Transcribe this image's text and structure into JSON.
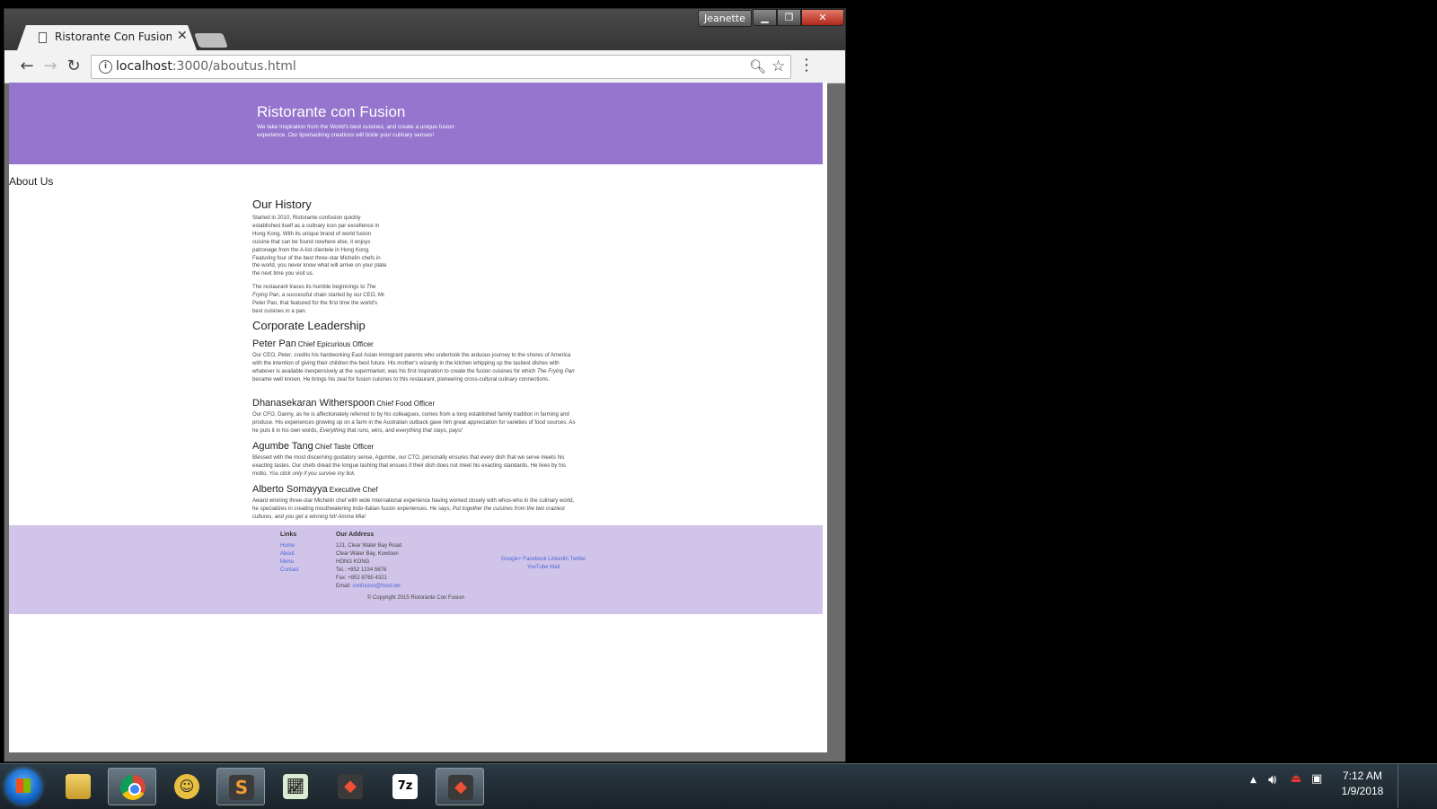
{
  "window": {
    "user_badge": "Jeanette",
    "tab_title": "Ristorante Con Fusion: A",
    "url_host": "localhost",
    "url_path": ":3000/aboutus.html"
  },
  "page": {
    "brand_title": "Ristorante con Fusion",
    "brand_tagline": "We take inspiration from the World's best cuisines, and create a unique fusion experience. Our lipsmacking creations will tickle your culinary senses!",
    "page_heading": "About Us",
    "history": {
      "heading": "Our History",
      "p1": "Started in 2010, Ristorante confusion quickly established itself as a culinary icon par excellence in Hong Kong. With its unique brand of world fusion cuisine that can be found nowhere else, it enjoys patronage from the A-list clientele in Hong Kong. Featuring four of the best three-star Michelin chefs in the world, you never know what will arrive on your plate the next time you visit us.",
      "p2_prefix": "The restaurant traces its humble beginnings to ",
      "p2_italic": "The Frying Pan",
      "p2_suffix": ", a successful chain started by our CEO, Mr. Peter Pan, that featured for the first time the world's best cuisines in a pan."
    },
    "leadership": {
      "heading": "Corporate Leadership",
      "leaders": [
        {
          "name": "Peter Pan",
          "role": "Chief Epicurious Officer",
          "bio_a": "Our CEO, ",
          "bio_a_italic": "Peter",
          "bio_b": ", credits his hardworking East Asian immigrant parents who undertook the arduous journey to the shores of America with the intention of giving their children the best future. His mother's wizardy in the kitchen whipping up the tastiest dishes with whatever is available inexpensively at the supermarket, was his first inspiration to create the fusion cuisines for which ",
          "bio_b_italic": "The Frying Pan",
          "bio_c": " became well known. He brings his zeal for fusion cuisines to this restaurant, pioneering cross-cultural culinary connections."
        },
        {
          "name": "Dhanasekaran Witherspoon",
          "role": "Chief Food Officer",
          "bio_a": "Our CFO, Danny, as he is affectionately referred to by his colleagues, comes from a long established family tradition in farming and produce. His experiences growing up on a farm in the Australian outback gave him great appreciation for varieties of food sources. As he puts it in his own words, ",
          "bio_a_italic": "Everything that runs, wins, and everything that stays, pays!",
          "bio_b": "",
          "bio_b_italic": "",
          "bio_c": ""
        },
        {
          "name": "Agumbe Tang",
          "role": "Chief Taste Officer",
          "bio_a": "Blessed with the most discerning gustatory sense, Agumbe, our CTO, personally ensures that every dish that we serve meets his exacting tastes. Our chefs dread the tongue lashing that ensues if their dish does not meet his exacting standards. He lives by his motto, ",
          "bio_a_italic": "You click only if you survive my lick.",
          "bio_b": "",
          "bio_b_italic": "",
          "bio_c": ""
        },
        {
          "name": "Alberto Somayya",
          "role": "Executive Chef",
          "bio_a": "Award winning three-star Michelin chef with wide International experience having worked closely with whos-who in the culinary world, he specializes in creating mouthwatering Indo-Italian fusion experiences. He says, ",
          "bio_a_italic": "Put together the cuisines from the two craziest cultures, and you get a winning hit! Amma Mia!",
          "bio_b": "",
          "bio_b_italic": "",
          "bio_c": ""
        }
      ]
    },
    "footer": {
      "links_heading": "Links",
      "links": [
        "Home",
        "About",
        "Menu",
        "Contact"
      ],
      "address_heading": "Our Address",
      "address_lines": [
        "121, Clear Water Bay Road",
        "Clear Water Bay, Kowloon",
        "HONG KONG",
        "Tel.: +852 1234 5678",
        "Fax: +852 8765 4321"
      ],
      "email_label": "Email: ",
      "email": "confusion@food.net",
      "social_line1": "Google+ Facebook LinkedIn Twitter",
      "social_line2": "YouTube Mail",
      "copyright": "© Copyright 2015 Ristorante Con Fusion"
    }
  },
  "taskbar": {
    "time": "7:12 AM",
    "date": "1/9/2018",
    "sublime_glyph": "S",
    "sevenzip_label": "7z"
  }
}
